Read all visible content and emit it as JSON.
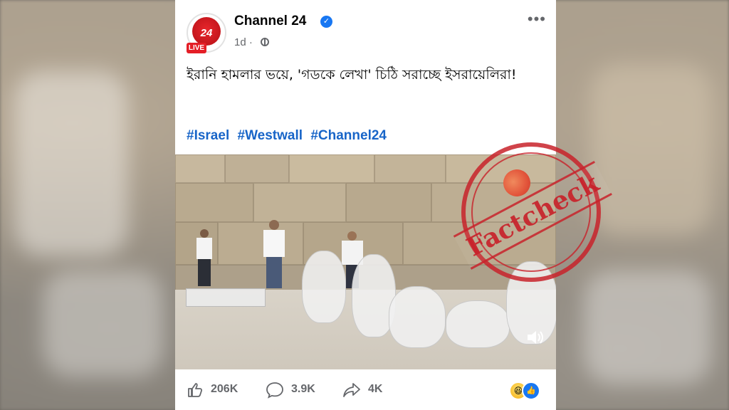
{
  "post": {
    "page_name": "Channel 24",
    "logo_text": "24",
    "live_badge": "LIVE",
    "time": "1d ·",
    "caption": "ইরানি হামলার ভয়ে, 'গডকে লেখা' চিঠি সরাচ্ছে ইসরায়েলিরা!",
    "hashtags": [
      "#Israel",
      "#Westwall",
      "#Channel24"
    ]
  },
  "stats": {
    "likes": "206K",
    "comments": "3.9K",
    "shares": "4K"
  },
  "overlay": {
    "stamp_text": "Factcheck"
  },
  "icons": {
    "verified": "verified-badge-icon",
    "globe": "globe-icon",
    "more": "more-options-icon",
    "like": "like-icon",
    "comment": "comment-icon",
    "share": "share-icon",
    "volume": "volume-icon"
  },
  "colors": {
    "brand_red": "#e41e26",
    "link_blue": "#1865c8",
    "facebook_blue": "#1877f2",
    "stamp_red": "#c8222a"
  }
}
